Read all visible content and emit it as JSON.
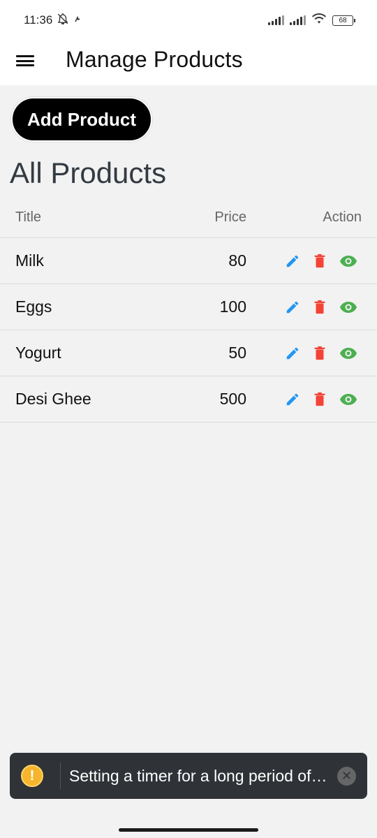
{
  "status_bar": {
    "time": "11:36",
    "battery": "68",
    "icons": [
      "mute-icon",
      "signal-icon",
      "wifi-icon",
      "battery-icon"
    ]
  },
  "header": {
    "title": "Manage Products",
    "menu_icon": "menu-icon"
  },
  "main": {
    "add_button_label": "Add Product",
    "section_title": "All Products",
    "table": {
      "headers": {
        "title": "Title",
        "price": "Price",
        "action": "Action"
      },
      "rows": [
        {
          "title": "Milk",
          "price": "80"
        },
        {
          "title": "Eggs",
          "price": "100"
        },
        {
          "title": "Yogurt",
          "price": "50"
        },
        {
          "title": "Desi Ghee",
          "price": "500"
        }
      ]
    },
    "action_icons": [
      "edit-icon",
      "delete-icon",
      "view-icon"
    ]
  },
  "toast": {
    "message": "Setting a timer for a long period of…"
  },
  "colors": {
    "edit": "#2196f3",
    "delete": "#f44336",
    "view": "#4caf50",
    "button": "#000000",
    "warning": "#f6b52c"
  }
}
